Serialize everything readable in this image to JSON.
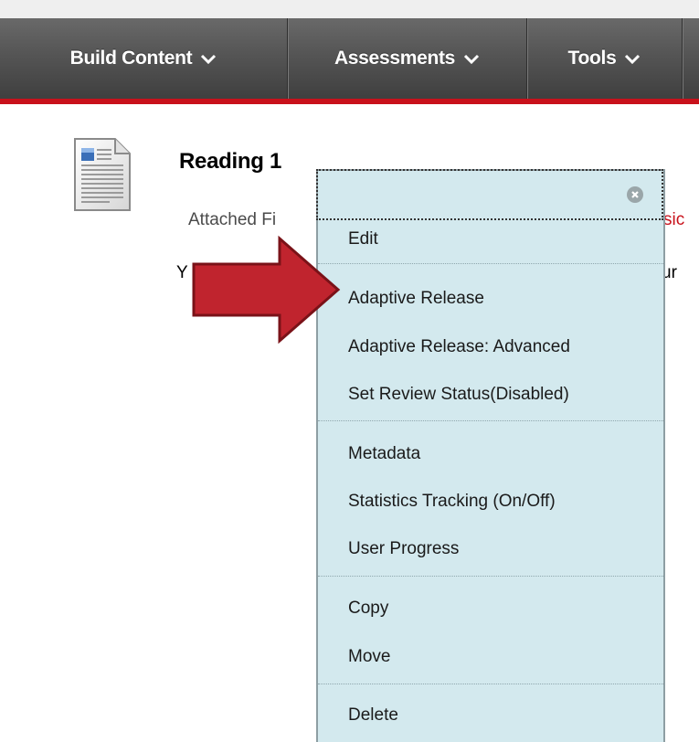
{
  "toolbar": {
    "items": [
      {
        "label": "Build Content"
      },
      {
        "label": "Assessments"
      },
      {
        "label": "Tools"
      }
    ]
  },
  "content_item": {
    "title": "Reading 1",
    "attached_label": "Attached Fi",
    "attached_tail": "sic",
    "desc_head": "Y",
    "desc_tail": "ur"
  },
  "context_menu": {
    "groups": [
      [
        "Edit"
      ],
      [
        "Adaptive Release",
        "Adaptive Release: Advanced",
        "Set Review Status(Disabled)"
      ],
      [
        "Metadata",
        "Statistics Tracking (On/Off)",
        "User Progress"
      ],
      [
        "Copy",
        "Move"
      ],
      [
        "Delete"
      ]
    ]
  },
  "colors": {
    "toolbar_bg": "#555555",
    "toolbar_accent": "#c8111b",
    "menu_bg": "#d3e9ee",
    "arrow_fill": "#c0242e"
  },
  "icons": {
    "document": "document-icon",
    "close": "close-icon",
    "chevron": "chevron-down-icon",
    "pointer": "red-arrow"
  }
}
